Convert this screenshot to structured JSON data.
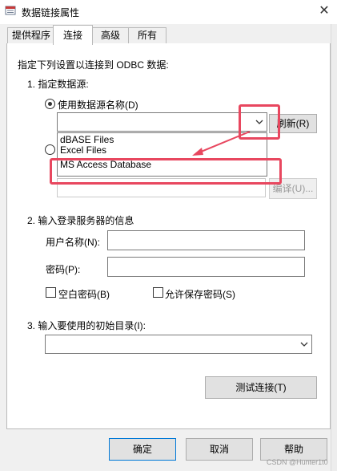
{
  "window": {
    "title": "数据链接属性",
    "close_glyph": "✕"
  },
  "tabs": [
    {
      "label": "提供程序",
      "active": false
    },
    {
      "label": "连接",
      "active": true
    },
    {
      "label": "高级",
      "active": false
    },
    {
      "label": "所有",
      "active": false
    }
  ],
  "connection": {
    "intro": "指定下列设置以连接到 ODBC 数据:",
    "step1": "1. 指定数据源:",
    "radio_dsn_label": "使用数据源名称(D)",
    "radio_dsn_selected": true,
    "dsn_value": "",
    "dsn_options": [
      "dBASE Files",
      "Excel Files",
      "MS Access Database"
    ],
    "refresh_label": "刷新(R)",
    "compile_label": "编译(U)...",
    "step2": "2. 输入登录服务器的信息",
    "username_label": "用户名称(N):",
    "username_value": "",
    "password_label": "密码(P):",
    "password_value": "",
    "blank_password_label": "空白密码(B)",
    "allow_save_password_label": "允许保存密码(S)",
    "step3": "3. 输入要使用的初始目录(I):",
    "initial_catalog_value": "",
    "test_connection_label": "测试连接(T)"
  },
  "footer": {
    "ok_label": "确定",
    "cancel_label": "取消",
    "help_label": "帮助"
  },
  "watermark": "CSDN @Hunter1t0",
  "annotation": {
    "color": "#e8475f"
  },
  "icons": {
    "dropdown": "chevron-down-icon",
    "close": "close-icon",
    "app": "data-link-icon"
  }
}
